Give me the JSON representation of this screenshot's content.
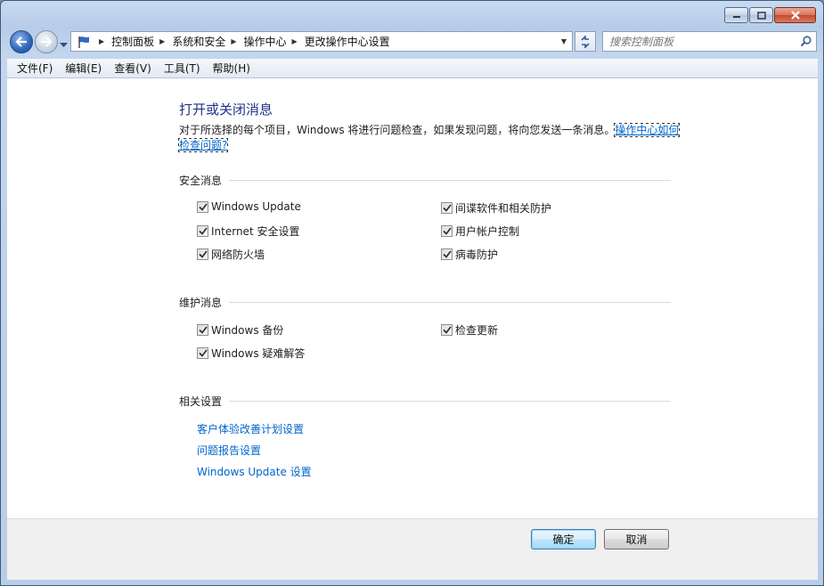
{
  "window": {
    "caption": {
      "minimize": "minimize",
      "maximize": "maximize",
      "close": "close"
    }
  },
  "address": {
    "breadcrumbs": [
      "控制面板",
      "系统和安全",
      "操作中心",
      "更改操作中心设置"
    ]
  },
  "search": {
    "placeholder": "搜索控制面板"
  },
  "menu": [
    "文件(F)",
    "编辑(E)",
    "查看(V)",
    "工具(T)",
    "帮助(H)"
  ],
  "main": {
    "title": "打开或关闭消息",
    "description": "对于所选择的每个项目，Windows 将进行问题检查，如果发现问题，将向您发送一条消息。",
    "description_link": "操作中心如何检查问题?",
    "security": {
      "heading": "安全消息",
      "items": [
        {
          "label": "Windows Update",
          "checked": true
        },
        {
          "label": "间谍软件和相关防护",
          "checked": true
        },
        {
          "label": "Internet 安全设置",
          "checked": true
        },
        {
          "label": "用户帐户控制",
          "checked": true
        },
        {
          "label": "网络防火墙",
          "checked": true
        },
        {
          "label": "病毒防护",
          "checked": true
        }
      ]
    },
    "maintenance": {
      "heading": "维护消息",
      "items": [
        {
          "label": "Windows 备份",
          "checked": true
        },
        {
          "label": "检查更新",
          "checked": true
        },
        {
          "label": "Windows 疑难解答",
          "checked": true
        }
      ]
    },
    "related": {
      "heading": "相关设置",
      "links": [
        "客户体验改善计划设置",
        "问题报告设置",
        "Windows Update 设置"
      ]
    }
  },
  "footer": {
    "ok": "确定",
    "cancel": "取消"
  },
  "colors": {
    "title": "#1e3287",
    "link": "#0066cc"
  }
}
